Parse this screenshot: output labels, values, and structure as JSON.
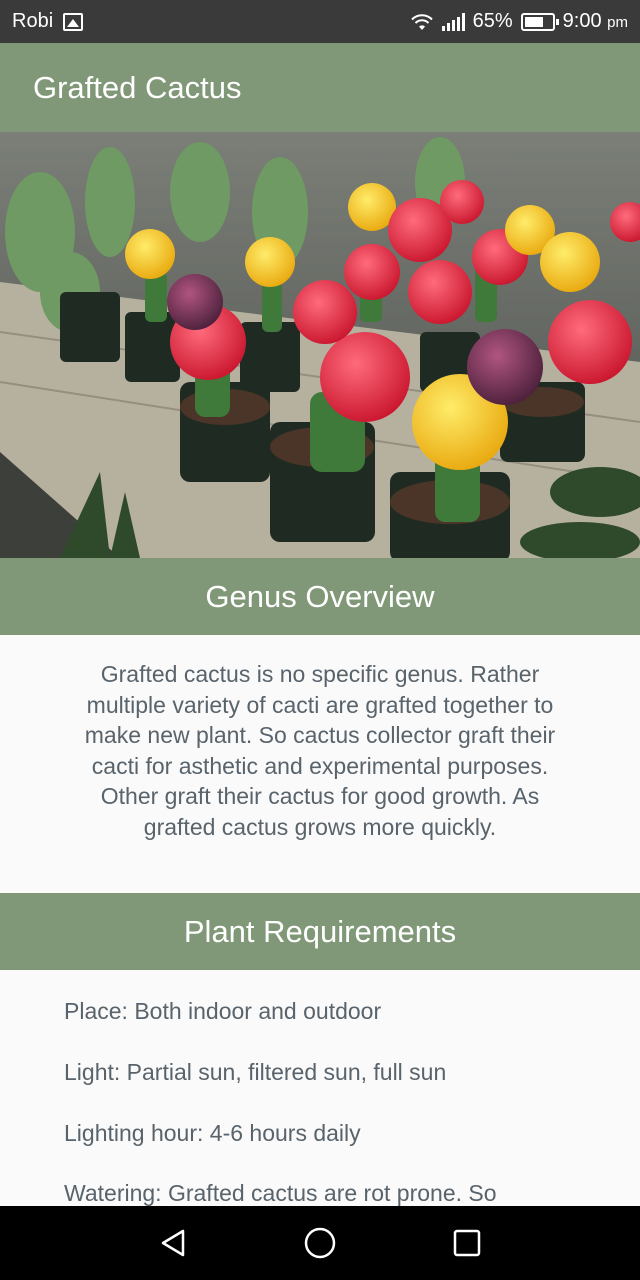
{
  "status_bar": {
    "carrier": "Robi",
    "battery": "65%",
    "time": "9:00",
    "time_suffix": "pm"
  },
  "app_bar": {
    "title": "Grafted Cactus"
  },
  "sections": {
    "overview": {
      "title": "Genus Overview",
      "body": "Grafted cactus is no specific genus. Rather multiple variety of cacti are grafted together to make new plant. So cactus collector graft their cacti for asthetic and experimental purposes. Other graft their cactus for good growth. As grafted cactus grows more quickly."
    },
    "requirements": {
      "title": "Plant Requirements",
      "items": [
        "Place: Both indoor and outdoor",
        "Light: Partial sun, filtered sun, full sun",
        "Lighting hour: 4-6 hours daily",
        "Watering: Grafted cactus are rot prone. So"
      ]
    }
  },
  "icons": {
    "status": [
      "image-icon",
      "wifi-icon",
      "signal-icon",
      "battery-icon"
    ],
    "nav": [
      "back-icon",
      "home-icon",
      "recents-icon"
    ]
  },
  "colors": {
    "header_green": "#809878",
    "status_bar": "#3a3a3a",
    "text_gray": "#59636b"
  }
}
